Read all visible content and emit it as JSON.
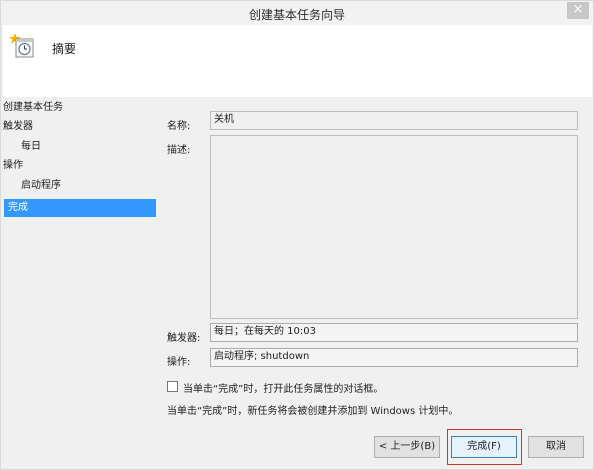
{
  "window": {
    "title": "创建基本任务向导",
    "close_glyph": "×"
  },
  "header": {
    "title": "摘要",
    "icon": "task-scheduler-icon"
  },
  "sidebar": {
    "items": [
      {
        "label": "创建基本任务",
        "level": 1,
        "selected": false
      },
      {
        "label": "触发器",
        "level": 1,
        "selected": false
      },
      {
        "label": "每日",
        "level": 2,
        "selected": false
      },
      {
        "label": "操作",
        "level": 1,
        "selected": false
      },
      {
        "label": "启动程序",
        "level": 2,
        "selected": false
      },
      {
        "label": "完成",
        "level": 1,
        "selected": true
      }
    ]
  },
  "form": {
    "name_label": "名称:",
    "name_value": "关机",
    "desc_label": "描述:",
    "desc_value": "",
    "trigger_label": "触发器:",
    "trigger_value": "每日；在每天的 10:03",
    "action_label": "操作:",
    "action_value": "启动程序; shutdown"
  },
  "options": {
    "open_properties_label": "当单击“完成”时，打开此任务属性的对话框。",
    "open_properties_checked": false,
    "info_text": "当单击“完成”时，新任务将会被创建并添加到 Windows 计划中。"
  },
  "buttons": {
    "back": "< 上一步(B)",
    "finish": "完成(F)",
    "cancel": "取消"
  },
  "colors": {
    "selection": "#3399ff",
    "focus_outline": "#c0392b"
  }
}
